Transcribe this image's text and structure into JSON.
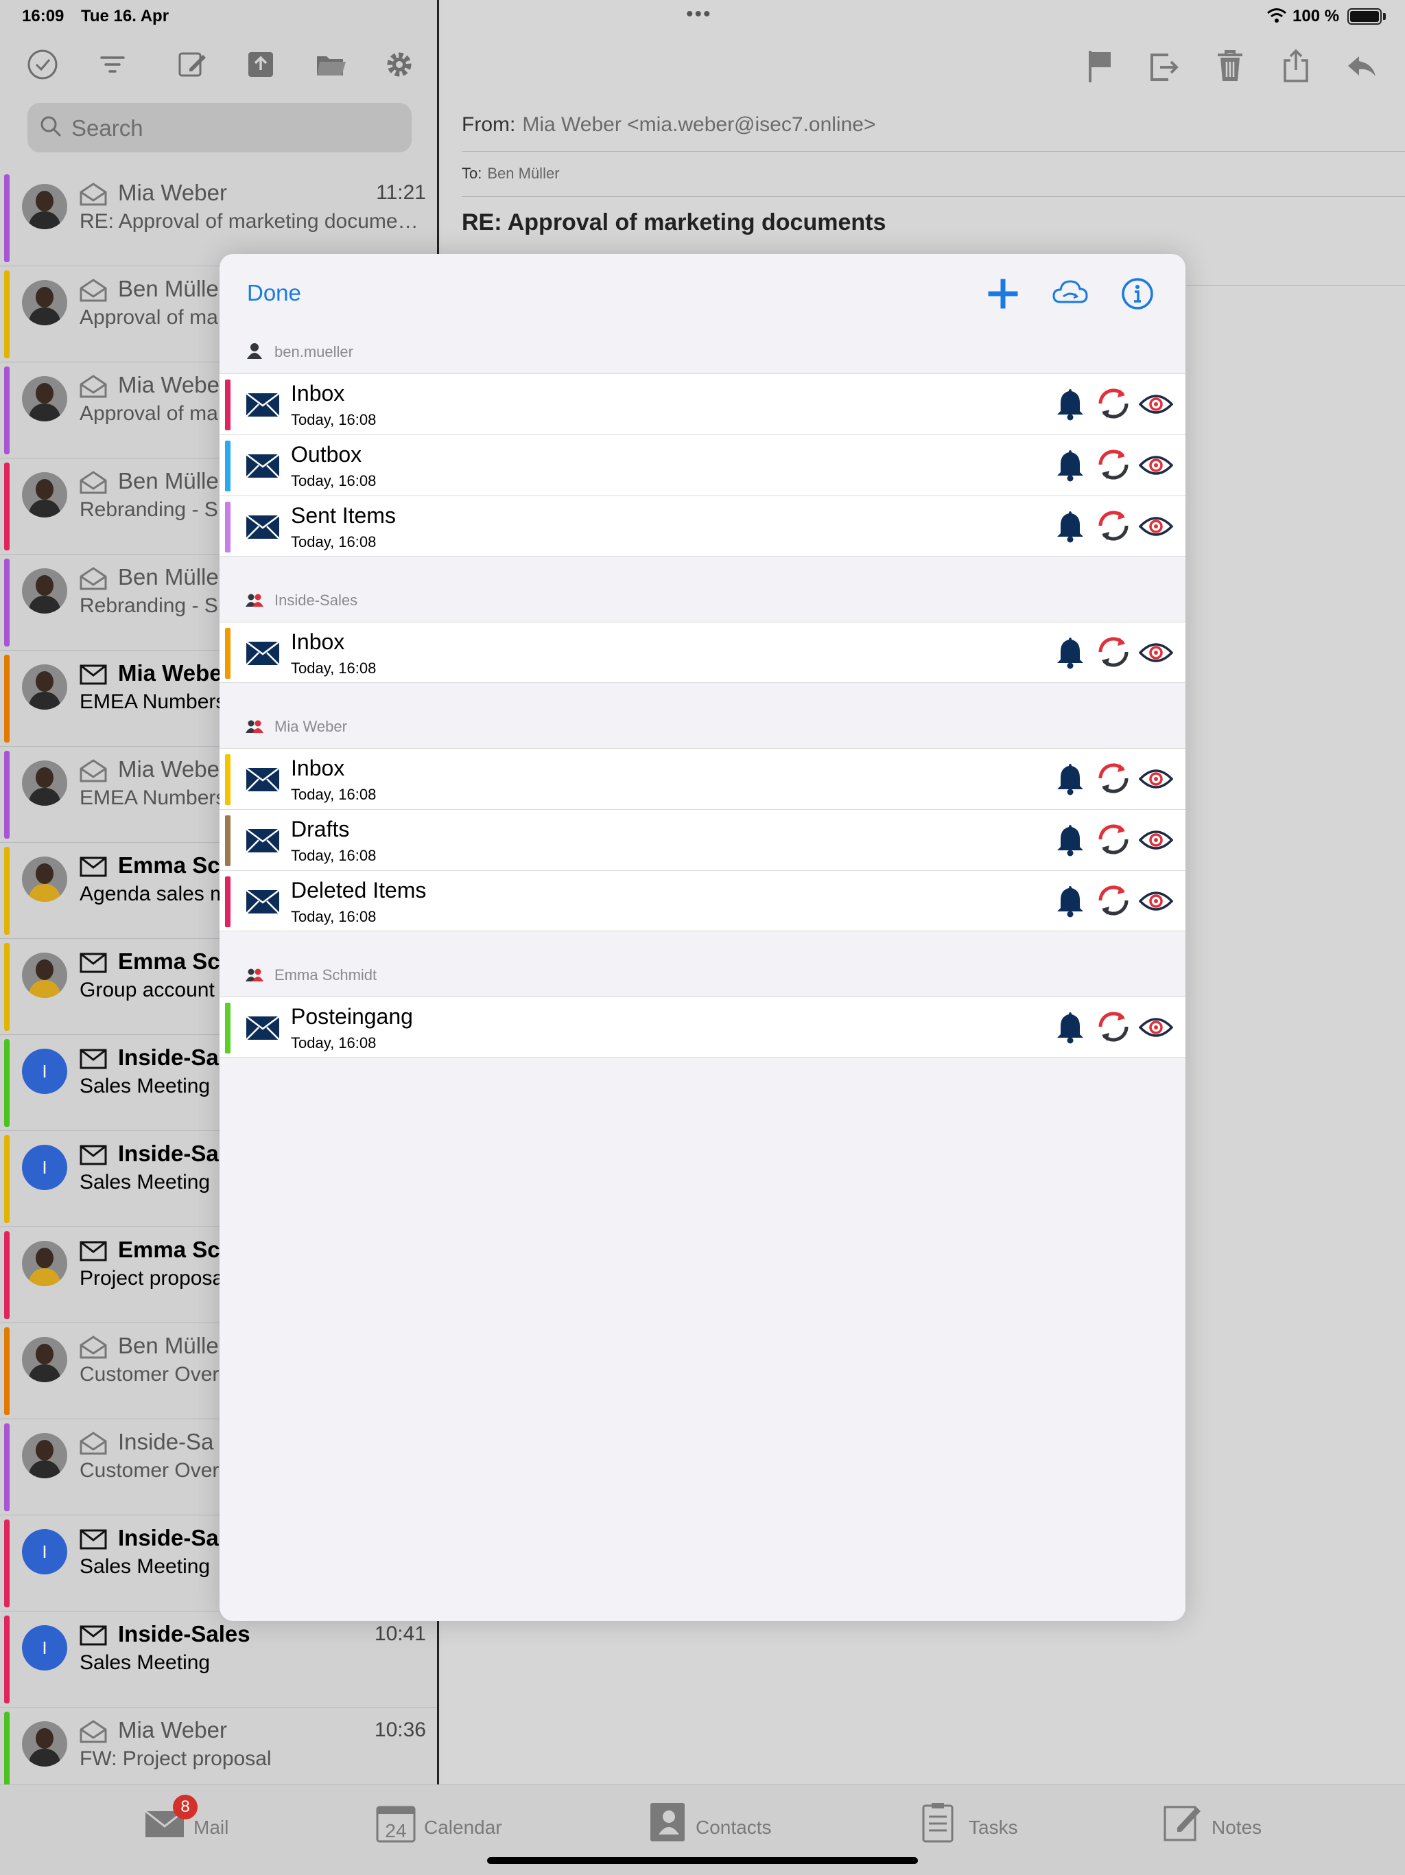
{
  "status_bar": {
    "time": "16:09",
    "date": "Tue 16. Apr",
    "battery": "100 %"
  },
  "search": {
    "placeholder": "Search"
  },
  "mail_list": [
    {
      "sender": "Mia Weber",
      "subject": "RE: Approval of marketing docume…",
      "time": "11:21",
      "bar_color": "#a855d4",
      "unread": false,
      "avatar": "person-dark"
    },
    {
      "sender": "Ben Mülle",
      "subject": "Approval of ma",
      "time": "",
      "bar_color": "#e0b400",
      "unread": false,
      "avatar": "person-dark"
    },
    {
      "sender": "Mia Webe",
      "subject": "Approval of ma",
      "time": "",
      "bar_color": "#a855d4",
      "unread": false,
      "avatar": "person-dark"
    },
    {
      "sender": "Ben Mülle",
      "subject": "Rebranding - S",
      "time": "",
      "bar_color": "#e0245e",
      "unread": false,
      "avatar": "person-dark"
    },
    {
      "sender": "Ben Mülle",
      "subject": "Rebranding - S",
      "time": "",
      "bar_color": "#a855d4",
      "unread": false,
      "avatar": "person-dark"
    },
    {
      "sender": "Mia Webe",
      "subject": "EMEA Numbers",
      "time": "",
      "bar_color": "#e07b00",
      "unread": true,
      "avatar": "person-dark"
    },
    {
      "sender": "Mia Webe",
      "subject": "EMEA Numbers",
      "time": "",
      "bar_color": "#a855d4",
      "unread": false,
      "avatar": "person-dark"
    },
    {
      "sender": "Emma Sc",
      "subject": "Agenda sales m",
      "time": "",
      "bar_color": "#e0b400",
      "unread": true,
      "avatar": "person-yellow"
    },
    {
      "sender": "Emma Sc",
      "subject": "Group account",
      "time": "",
      "bar_color": "#e0b400",
      "unread": true,
      "avatar": "person-yellow"
    },
    {
      "sender": "Inside-Sal",
      "subject": "Sales Meeting",
      "time": "",
      "bar_color": "#4cc21f",
      "unread": true,
      "avatar": "I"
    },
    {
      "sender": "Inside-Sal",
      "subject": "Sales Meeting",
      "time": "",
      "bar_color": "#e0b400",
      "unread": true,
      "avatar": "I"
    },
    {
      "sender": "Emma Sc",
      "subject": "Project proposa",
      "time": "",
      "bar_color": "#e0245e",
      "unread": true,
      "avatar": "person-yellow"
    },
    {
      "sender": "Ben Mülle",
      "subject": "Customer Over",
      "time": "",
      "bar_color": "#e07b00",
      "unread": false,
      "avatar": "person-dark"
    },
    {
      "sender": "Inside-Sa",
      "subject": "Customer Over",
      "time": "",
      "bar_color": "#a855d4",
      "unread": false,
      "avatar": "person-dark"
    },
    {
      "sender": "Inside-Sal",
      "subject": "Sales Meeting",
      "time": "",
      "bar_color": "#e0245e",
      "unread": true,
      "avatar": "I"
    },
    {
      "sender": "Inside-Sales",
      "subject": "Sales Meeting",
      "time": "10:41",
      "bar_color": "#e0245e",
      "unread": true,
      "avatar": "I"
    },
    {
      "sender": "Mia Weber",
      "subject": "FW: Project proposal",
      "time": "10:36",
      "bar_color": "#4cc21f",
      "unread": false,
      "avatar": "person-dark"
    }
  ],
  "email": {
    "from_label": "From:",
    "from_value": "Mia Weber <mia.weber@isec7.online>",
    "to_label": "To:",
    "to_value": "Ben Müller",
    "subject": "RE: Approval of marketing documents"
  },
  "tabbar": [
    {
      "label": "Mail",
      "badge": "8"
    },
    {
      "label": "Calendar",
      "icon_text": "24"
    },
    {
      "label": "Contacts"
    },
    {
      "label": "Tasks"
    },
    {
      "label": "Notes"
    }
  ],
  "modal": {
    "done_label": "Done",
    "sections": [
      {
        "header": "ben.mueller",
        "icon": "single-user-icon",
        "folders": [
          {
            "name": "Inbox",
            "time": "Today, 16:08",
            "color": "#e0245e"
          },
          {
            "name": "Outbox",
            "time": "Today, 16:08",
            "color": "#2aa8f0"
          },
          {
            "name": "Sent Items",
            "time": "Today, 16:08",
            "color": "#c77ee6"
          }
        ]
      },
      {
        "header": "Inside-Sales",
        "icon": "group-icon",
        "folders": [
          {
            "name": "Inbox",
            "time": "Today, 16:08",
            "color": "#f09a00"
          }
        ]
      },
      {
        "header": "Mia Weber",
        "icon": "group-icon",
        "folders": [
          {
            "name": "Inbox",
            "time": "Today, 16:08",
            "color": "#f5c400"
          },
          {
            "name": "Drafts",
            "time": "Today, 16:08",
            "color": "#9c7a4e"
          },
          {
            "name": "Deleted Items",
            "time": "Today, 16:08",
            "color": "#e0245e"
          }
        ]
      },
      {
        "header": "Emma Schmidt",
        "icon": "group-icon",
        "folders": [
          {
            "name": "Posteingang",
            "time": "Today, 16:08",
            "color": "#5ccf2a"
          }
        ]
      }
    ]
  },
  "colors": {
    "accent": "#1a7ae0",
    "navy": "#0c2d57",
    "sync_red": "#e0303a"
  }
}
